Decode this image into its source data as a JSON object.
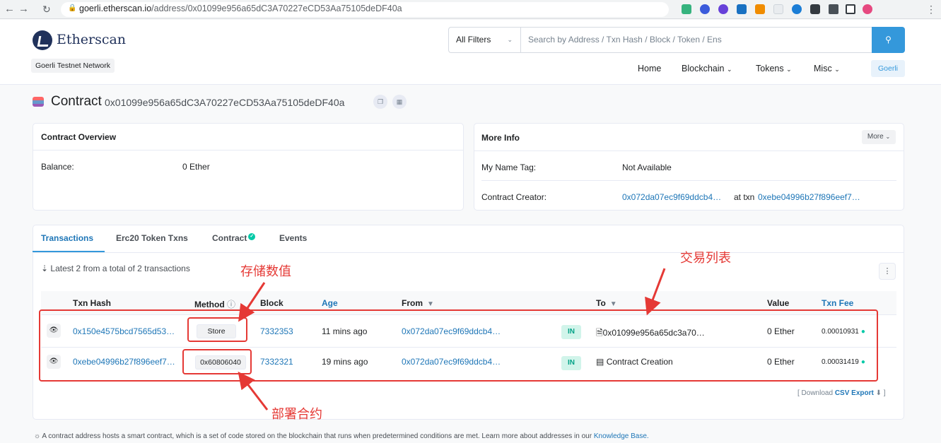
{
  "browser": {
    "url_host": "goerli.etherscan.io",
    "url_path": "/address/0x01099e956a65dC3A70227eCD53Aa75105deDF40a"
  },
  "header": {
    "logo_text": "Etherscan",
    "network": "Goerli Testnet Network",
    "filter": "All Filters",
    "search_placeholder": "Search by Address / Txn Hash / Block / Token / Ens",
    "nav": [
      "Home",
      "Blockchain",
      "Tokens",
      "Misc"
    ],
    "network_button": "Goerli"
  },
  "contract": {
    "title": "Contract",
    "address": "0x01099e956a65dC3A70227eCD53Aa75105deDF40a"
  },
  "overview": {
    "heading": "Contract Overview",
    "balance_label": "Balance:",
    "balance_value": "0 Ether"
  },
  "more_info": {
    "heading": "More Info",
    "more_button": "More",
    "name_tag_label": "My Name Tag:",
    "name_tag_value": "Not Available",
    "creator_label": "Contract Creator:",
    "creator_address": "0x072da07ec9f69ddcb4…",
    "at_txn": "at txn",
    "creator_txn": "0xebe04996b27f896eef7…"
  },
  "tabs": [
    "Transactions",
    "Erc20 Token Txns",
    "Contract",
    "Events"
  ],
  "tx_summary": "Latest 2 from a total of 2 transactions",
  "table": {
    "headers": {
      "hash": "Txn Hash",
      "method": "Method",
      "block": "Block",
      "age": "Age",
      "from": "From",
      "to": "To",
      "value": "Value",
      "fee": "Txn Fee"
    },
    "rows": [
      {
        "hash": "0x150e4575bcd7565d53…",
        "method": "Store",
        "block": "7332353",
        "age": "11 mins ago",
        "from": "0x072da07ec9f69ddcb4…",
        "direction": "IN",
        "to": "0x01099e956a65dc3a70…",
        "value": "0 Ether",
        "fee": "0.00010931"
      },
      {
        "hash": "0xebe04996b27f896eef7…",
        "method": "0x60806040",
        "block": "7332321",
        "age": "19 mins ago",
        "from": "0x072da07ec9f69ddcb4…",
        "direction": "IN",
        "to": "Contract Creation",
        "value": "0 Ether",
        "fee": "0.00031419"
      }
    ]
  },
  "download": {
    "prefix": "[ Download",
    "link": "CSV Export",
    "suffix": "]"
  },
  "annotations": {
    "store_value": "存储数值",
    "tx_list": "交易列表",
    "deploy": "部署合约"
  },
  "footer": {
    "text": "A contract address hosts a smart contract, which is a set of code stored on the blockchain that runs when predetermined conditions are met. Learn more about addresses in our",
    "link": "Knowledge Base."
  },
  "colors": {
    "accent": "#3498db",
    "link": "#1e76b7",
    "annotation": "#e53935",
    "in_badge": "#d1f4ea"
  }
}
